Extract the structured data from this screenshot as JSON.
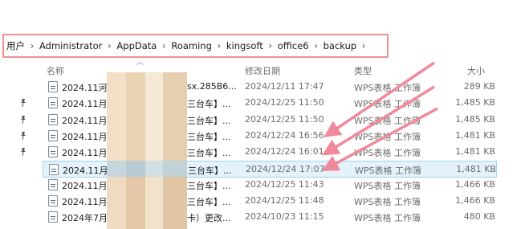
{
  "breadcrumb": [
    "用户",
    "Administrator",
    "AppData",
    "Roaming",
    "kingsoft",
    "office6",
    "backup"
  ],
  "columns": {
    "name": "名称",
    "date": "修改日期",
    "type": "类型",
    "size": "大小"
  },
  "files": [
    {
      "name": "2024.11河",
      "tail": "sx.285B6...",
      "date": "2024/12/11 17:47",
      "type": "WPS表格 工作簿",
      "size": "289 KB",
      "pinned": false,
      "selected": false
    },
    {
      "name": "2024.11月",
      "tail": "三台车】...",
      "date": "2024/12/25 11:50",
      "type": "WPS表格 工作簿",
      "size": "1,485 KB",
      "pinned": true,
      "selected": false
    },
    {
      "name": "2024.11月",
      "tail": "三台车】...",
      "date": "2024/12/25 11:50",
      "type": "WPS表格 工作簿",
      "size": "1,485 KB",
      "pinned": true,
      "selected": false
    },
    {
      "name": "2024.11月",
      "tail": "三台车】...",
      "date": "2024/12/24 16:56",
      "type": "WPS表格 工作簿",
      "size": "1,481 KB",
      "pinned": true,
      "selected": false
    },
    {
      "name": "2024.11月",
      "tail": "三台车】...",
      "date": "2024/12/24 16:01",
      "type": "WPS表格 工作簿",
      "size": "1,481 KB",
      "pinned": true,
      "selected": false
    },
    {
      "name": "2024.11月",
      "tail": "三台车】...",
      "date": "2024/12/24 17:07",
      "type": "WPS表格 工作簿",
      "size": "1,481 KB",
      "pinned": false,
      "selected": true
    },
    {
      "name": "2024.11月",
      "tail": "三台车】...",
      "date": "2024/12/25 11:43",
      "type": "WPS表格 工作簿",
      "size": "1,466 KB",
      "pinned": false,
      "selected": false
    },
    {
      "name": "2024.11月",
      "tail": "三台车】...",
      "date": "2024/12/25 11:48",
      "type": "WPS表格 工作簿",
      "size": "1,466 KB",
      "pinned": false,
      "selected": false
    },
    {
      "name": "2024年7月",
      "tail": "卡）更改...",
      "date": "2024/10/23 11:15",
      "type": "WPS表格 工作簿",
      "size": "480 KB",
      "pinned": false,
      "selected": false
    }
  ],
  "colors": {
    "address_outline": "#ef8f8f",
    "annotation_arrow": "#f08a9a",
    "selection_bg": "#e4f2fb",
    "selection_border": "#9ed2ef"
  },
  "icons": {
    "file": "spreadsheet-file-icon",
    "pin": "pin-icon",
    "separator": "chevron-right-icon"
  }
}
